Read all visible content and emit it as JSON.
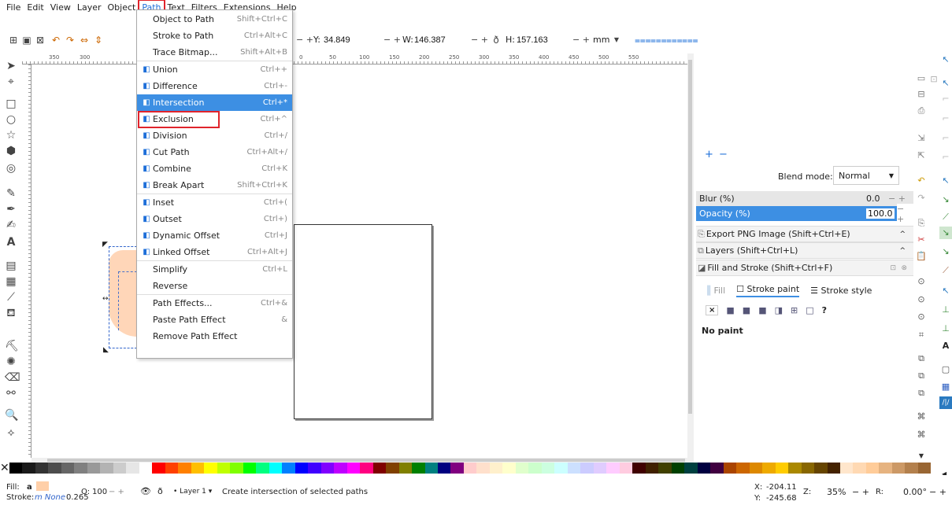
{
  "menubar": {
    "items": [
      {
        "label": "File",
        "active": false
      },
      {
        "label": "Edit",
        "active": false
      },
      {
        "label": "View",
        "active": false
      },
      {
        "label": "Layer",
        "active": false
      },
      {
        "label": "Object",
        "active": false
      },
      {
        "label": "Path",
        "active": true
      },
      {
        "label": "Text",
        "active": false
      },
      {
        "label": "Filters",
        "active": false
      },
      {
        "label": "Extensions",
        "active": false
      },
      {
        "label": "Help",
        "active": false
      }
    ]
  },
  "toolbar": {
    "y_label": "Y:",
    "y_value": "34.849",
    "w_label": "W:",
    "w_value": "146.387",
    "h_label": "H:",
    "h_value": "157.163",
    "units": "mm",
    "plus_minus": "− +"
  },
  "ruler": {
    "top_ticks": [
      "350",
      "300",
      "0",
      "50",
      "100",
      "150",
      "200",
      "250",
      "300",
      "350",
      "400",
      "450",
      "500",
      "550"
    ]
  },
  "path_menu": {
    "items": [
      {
        "label": "Object to Path",
        "accel": "Shift+Ctrl+C",
        "icon": ""
      },
      {
        "label": "Stroke to Path",
        "accel": "Ctrl+Alt+C",
        "icon": ""
      },
      {
        "label": "Trace Bitmap...",
        "accel": "Shift+Alt+B",
        "icon": ""
      },
      {
        "label": "Union",
        "accel": "Ctrl++",
        "icon": "union-icon"
      },
      {
        "label": "Difference",
        "accel": "Ctrl+-",
        "icon": "difference-icon"
      },
      {
        "label": "Intersection",
        "accel": "Ctrl+*",
        "icon": "intersection-icon",
        "highlighted": true
      },
      {
        "label": "Exclusion",
        "accel": "Ctrl+^",
        "icon": "exclusion-icon"
      },
      {
        "label": "Division",
        "accel": "Ctrl+/",
        "icon": "division-icon"
      },
      {
        "label": "Cut Path",
        "accel": "Ctrl+Alt+/",
        "icon": "cut-path-icon"
      },
      {
        "label": "Combine",
        "accel": "Ctrl+K",
        "icon": "combine-icon"
      },
      {
        "label": "Break Apart",
        "accel": "Shift+Ctrl+K",
        "icon": "break-apart-icon"
      },
      {
        "label": "Inset",
        "accel": "Ctrl+(",
        "icon": "inset-icon"
      },
      {
        "label": "Outset",
        "accel": "Ctrl+)",
        "icon": "outset-icon"
      },
      {
        "label": "Dynamic Offset",
        "accel": "Ctrl+J",
        "icon": "dynamic-offset-icon"
      },
      {
        "label": "Linked Offset",
        "accel": "Ctrl+Alt+J",
        "icon": "linked-offset-icon"
      },
      {
        "label": "Simplify",
        "accel": "Ctrl+L",
        "icon": ""
      },
      {
        "label": "Reverse",
        "accel": "",
        "icon": ""
      },
      {
        "label": "Path Effects...",
        "accel": "Ctrl+&",
        "icon": ""
      },
      {
        "label": "Paste Path Effect",
        "accel": "&",
        "icon": ""
      },
      {
        "label": "Remove Path Effect",
        "accel": "",
        "icon": ""
      }
    ]
  },
  "panel": {
    "blend_label": "Blend mode:",
    "blend_value": "Normal",
    "blur_label": "Blur (%)",
    "blur_value": "0.0",
    "blur_level": 0.0,
    "opacity_label": "Opacity (%)",
    "opacity_value": "100.0",
    "opacity_level": 100.0,
    "export_label": "Export PNG Image (Shift+Ctrl+E)",
    "layers_label": "Layers (Shift+Ctrl+L)",
    "fill_stroke_label": "Fill and Stroke (Shift+Ctrl+F)",
    "tab_fill": "Fill",
    "tab_stroke_paint": "Stroke paint",
    "tab_stroke_style": "Stroke style",
    "no_paint": "No paint",
    "paint_question": "?"
  },
  "statusbar": {
    "fill_label": "Fill:",
    "fill_value": "a",
    "stroke_label": "Stroke:",
    "stroke_value": "m None",
    "stroke_width": "0.265",
    "opacity_label": "O:",
    "opacity_value": "100",
    "layer_label": "Layer 1",
    "message": "Create intersection of selected paths",
    "x_label": "X:",
    "x_value": "-204.11",
    "y_label": "Y:",
    "y_value": "-245.68",
    "zoom_label": "Z:",
    "zoom_value": "35%",
    "rotate_label": "R:",
    "rotate_value": "0.00°",
    "fill_color": "#ffcfa8"
  },
  "colors": {
    "accent": "#3d8fe3",
    "highlight_box": "#e0242c",
    "peach": "#ffd6b8"
  },
  "palette": [
    "#000000",
    "#1a1a1a",
    "#333333",
    "#4d4d4d",
    "#666666",
    "#808080",
    "#999999",
    "#b3b3b3",
    "#cccccc",
    "#e6e6e6",
    "#ffffff",
    "#ff0000",
    "#ff4000",
    "#ff8000",
    "#ffbf00",
    "#ffff00",
    "#bfff00",
    "#80ff00",
    "#00ff00",
    "#00ff80",
    "#00ffff",
    "#0080ff",
    "#0000ff",
    "#4000ff",
    "#8000ff",
    "#bf00ff",
    "#ff00ff",
    "#ff0080",
    "#800000",
    "#804000",
    "#808000",
    "#008000",
    "#008080",
    "#000080",
    "#800080",
    "#ffcccc",
    "#ffe0cc",
    "#fff0cc",
    "#ffffcc",
    "#e0ffcc",
    "#ccffcc",
    "#ccffe0",
    "#ccffff",
    "#cce0ff",
    "#ccccff",
    "#e0ccff",
    "#ffccff",
    "#ffcce0",
    "#400000",
    "#402000",
    "#404000",
    "#004000",
    "#004040",
    "#000040",
    "#400040",
    "#aa4400",
    "#cc6600",
    "#dd8800",
    "#eeaa00",
    "#ffcc00",
    "#aa8800",
    "#886600",
    "#664400",
    "#442200",
    "#ffe6cc",
    "#ffd9b3",
    "#ffcc99",
    "#e6b380",
    "#cc9966",
    "#b3804d",
    "#996633"
  ]
}
